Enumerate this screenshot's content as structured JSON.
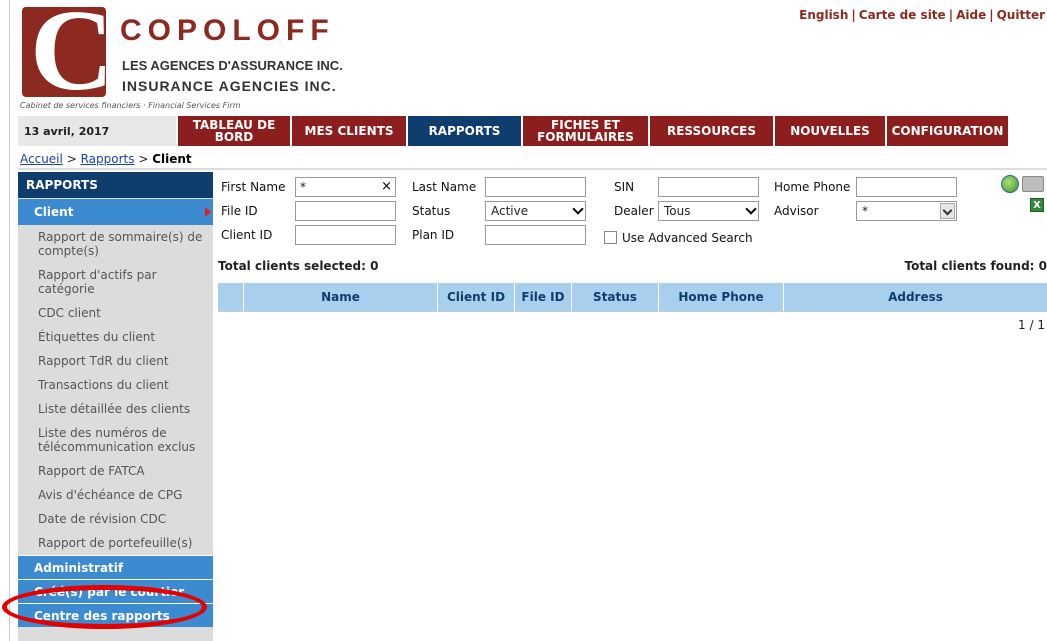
{
  "logo": {
    "letter": "C",
    "name": "COPOLOFF",
    "line1": "LES AGENCES D'ASSURANCE INC.",
    "line2": "INSURANCE AGENCIES INC.",
    "tagline": "Cabinet de services financiers · Financial Services Firm"
  },
  "toplinks": {
    "english": "English",
    "sitemap": "Carte de site",
    "help": "Aide",
    "quit": "Quitter",
    "separator": "|"
  },
  "nav": {
    "date": "13 avril, 2017",
    "items": [
      "TABLEAU DE BORD",
      "MES CLIENTS",
      "RAPPORTS",
      "FICHES ET FORMULAIRES",
      "RESSOURCES",
      "NOUVELLES",
      "CONFIGURATION"
    ]
  },
  "breadcrumb": {
    "home": "Accueil",
    "sep": ">",
    "reports": "Rapports",
    "current": "Client"
  },
  "sidebar": {
    "heading": "RAPPORTS",
    "active": "Client",
    "links": [
      "Rapport de sommaire(s) de compte(s)",
      "Rapport d'actifs par catégorie",
      "CDC client",
      "Étiquettes du client",
      "Rapport TdR du client",
      "Transactions du client",
      "Liste détaillée des clients",
      "Liste des numéros de télécommunication exclus",
      "Rapport de FATCA",
      "Avis d'échéance de CPG",
      "Date de révision CDC",
      "Rapport de portefeuille(s)"
    ],
    "sections": [
      "Administratif",
      "Créé(s) par le courtier",
      "Centre des rapports"
    ]
  },
  "form": {
    "first_name_label": "First Name",
    "first_name_value": "*",
    "last_name_label": "Last Name",
    "last_name_value": "",
    "sin_label": "SIN",
    "sin_value": "",
    "home_phone_label": "Home Phone",
    "home_phone_value": "",
    "file_id_label": "File ID",
    "file_id_value": "",
    "status_label": "Status",
    "status_value": "Active",
    "dealer_label": "Dealer",
    "dealer_value": "Tous",
    "advisor_label": "Advisor",
    "advisor_value": "*",
    "client_id_label": "Client ID",
    "client_id_value": "",
    "plan_id_label": "Plan ID",
    "plan_id_value": "",
    "advanced_label": "Use Advanced Search",
    "clear_glyph": "×"
  },
  "totals": {
    "selected": "Total clients selected: 0",
    "found": "Total clients found: 0"
  },
  "table": {
    "columns": [
      "",
      "Name",
      "Client ID",
      "File ID",
      "Status",
      "Home Phone",
      "Address"
    ]
  },
  "pager": "1 / 1",
  "colors": {
    "brand_red": "#8c1e1e",
    "nav_active": "#0f3d6e",
    "sidebar_blue": "#3c8bd1",
    "table_header": "#a9cfee",
    "highlight_oval": "#e50000"
  }
}
